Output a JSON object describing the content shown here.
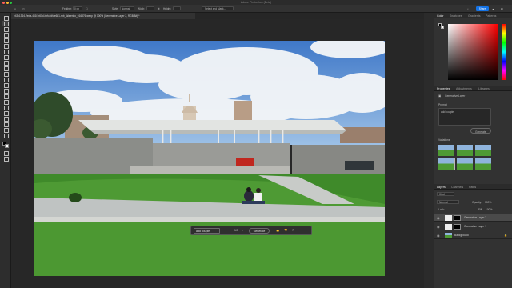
{
  "window": {
    "title": "Adobe Photoshop (Beta)"
  },
  "options_bar": {
    "feather_label": "Feather:",
    "feather_value": "0 px",
    "style_label": "Style:",
    "style_value": "Normal",
    "width_label": "Width:",
    "height_label": "Height:",
    "select_mask": "Select and Mask...",
    "share": "Share"
  },
  "document": {
    "tab_title": "e43c1364-2eda-461f-b61d-bbfc2dfae681-rbb_Waterloo_016876.webp @ 100% (Generative Layer 2, RGB/8#) *"
  },
  "context_bar": {
    "prompt_value": "add couple",
    "counter": "1/3",
    "generate_label": "Generate"
  },
  "color_panel": {
    "tabs": [
      "Color",
      "Swatches",
      "Gradients",
      "Patterns"
    ],
    "accent": "#ff0000"
  },
  "properties_panel": {
    "tabs": [
      "Properties",
      "Adjustments",
      "Libraries"
    ],
    "layer_type": "Generative Layer",
    "prompt_label": "Prompt",
    "prompt_value": "add couple",
    "generate_label": "Generate",
    "variations_label": "Variations"
  },
  "layers_panel": {
    "tabs": [
      "Layers",
      "Channels",
      "Paths"
    ],
    "filter_label": "Kind",
    "blend_mode": "Normal",
    "opacity_label": "Opacity:",
    "opacity_value": "100%",
    "lock_label": "Lock:",
    "fill_label": "Fill:",
    "fill_value": "100%",
    "layers": [
      {
        "name": "Generative Layer 2",
        "selected": true
      },
      {
        "name": "Generative Layer 1",
        "selected": false
      },
      {
        "name": "Background",
        "selected": false
      }
    ]
  }
}
